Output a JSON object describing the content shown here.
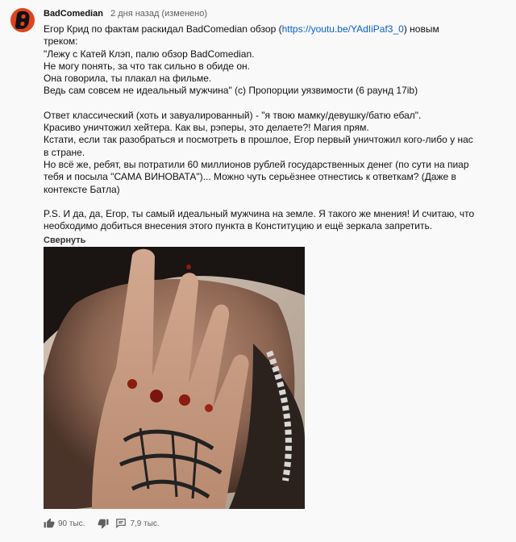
{
  "comment": {
    "author": "BadComedian",
    "time": "2 дня назад (изменено)",
    "lines": {
      "l1_pre": "Егор Крид по фактам раскидал BadComedian обзор (",
      "l1_link": "https://youtu.be/YAdIiPaf3_0",
      "l1_post": ") новым",
      "l2": "треком:",
      "l3": "\"Лежу с Катей Клэп, палю обзор BadComedian.",
      "l4": "Не могу понять, за что так сильно в обиде он.",
      "l5": "Она говорила, ты плакал на фильме.",
      "l6": "Ведь сам совсем не идеальный мужчина\" (с) Пропорции уязвимости (6 раунд 17ib)",
      "l7": "Ответ классический (хоть и завуалированный) - \"я твою мамку/девушку/батю ебал\".",
      "l8": "Красиво уничтожил хейтера. Как вы, рэперы, это делаете?! Магия прям.",
      "l9": "Кстати, если так разобраться и посмотреть в прошлое, Егор первый уничтожил кого-либо у нас",
      "l10": "в стране.",
      "l11": "Но всё же, ребят, вы потратили 60 миллионов рублей государственных денег (по сути на пиар",
      "l12": "тебя и посыла \"САМА ВИНОВАТА\")... Можно чуть серьёзнее отнестись к ответкам? (Даже в",
      "l13": "контексте Батла)",
      "l14": "P.S. И да, да, Егор, ты самый идеальный мужчина на земле. Я такого же мнения! И считаю, что",
      "l15": "необходимо добиться внесения этого пункта в Конституцию и ещё зеркала запретить."
    },
    "collapse_label": "Свернуть",
    "likes": "90 тыс.",
    "replies": "7,9 тыс."
  },
  "icons": {
    "avatar": "badcomedian-logo-icon",
    "like": "thumb-up-icon",
    "dislike": "thumb-down-icon",
    "reply": "comment-icon"
  },
  "colors": {
    "link": "#065fd4",
    "avatar_bg": "#e0431c",
    "meta": "#606060"
  }
}
